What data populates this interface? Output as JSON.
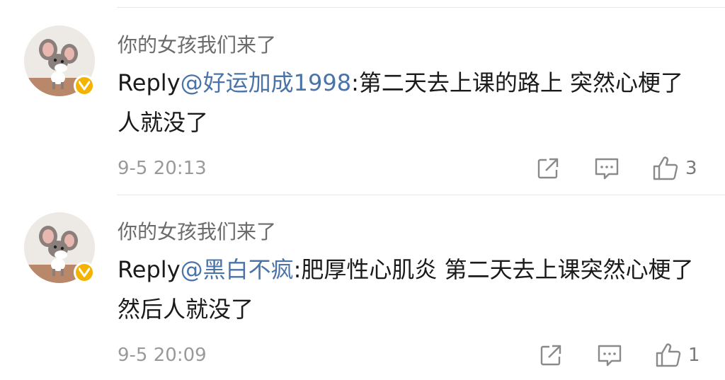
{
  "comments": [
    {
      "username": "你的女孩我们来了",
      "reply_prefix": "Reply",
      "mention": "@好运加成1998",
      "text": ":第二天去上课的路上 突然心梗了 人就没了",
      "timestamp": "9-5 20:13",
      "like_count": "3"
    },
    {
      "username": "你的女孩我们来了",
      "reply_prefix": "Reply",
      "mention": "@黑白不疯",
      "text": ":肥厚性心肌炎 第二天去上课突然心梗了 然后人就没了",
      "timestamp": "9-5 20:09",
      "like_count": "1"
    }
  ],
  "colors": {
    "mention": "#4a74a8",
    "badge": "#f3b300",
    "meta": "#9a9a9a"
  },
  "icons": {
    "share": "share-icon",
    "comment": "comment-icon",
    "like": "thumbs-up-icon",
    "verified": "verified-badge-icon"
  }
}
